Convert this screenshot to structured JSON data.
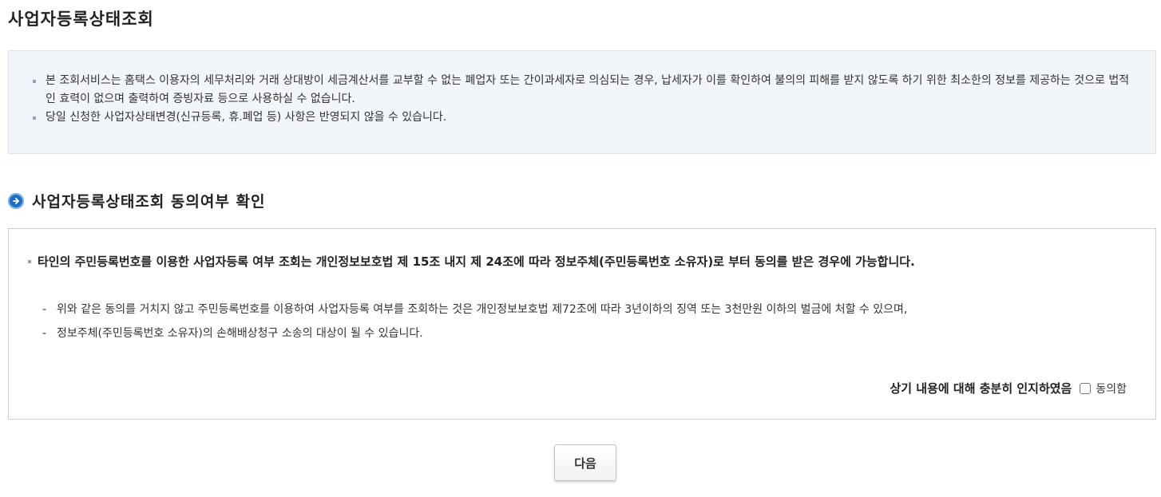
{
  "page": {
    "title": "사업자등록상태조회"
  },
  "notice": {
    "items": [
      "본 조회서비스는 홈택스 이용자의 세무처리와 거래 상대방이 세금계산서를 교부할 수 없는 폐업자 또는 간이과세자로 의심되는 경우, 납세자가 이를 확인하여 불의의 피해를 받지 않도록 하기 위한 최소한의 정보를 제공하는 것으로 법적인 효력이 없으며 출력하여 증빙자료 등으로 사용하실 수 없습니다.",
      "당일 신청한 사업자상태변경(신규등록, 휴.폐업 등) 사항은 반영되지 않을 수 있습니다."
    ]
  },
  "consent_section": {
    "title": "사업자등록상태조회 동의여부 확인",
    "main_text": "타인의 주민등록번호를 이용한 사업자등록 여부 조회는 개인정보보호법 제 15조 내지 제 24조에 따라 정보주체(주민등록번호 소유자)로 부터 동의를 받은 경우에 가능합니다.",
    "warnings": [
      "위와 같은 동의를 거치지 않고 주민등록번호를 이용하여 사업자등록 여부를 조회하는 것은 개인정보보호법 제72조에 따라 3년이하의 징역 또는 3천만원 이하의 벌금에 처할 수 있으며,",
      "정보주체(주민등록번호 소유자)의 손해배상청구 소송의 대상이 될 수 있습니다."
    ],
    "acknowledge_text": "상기 내용에 대해 충분히 인지하였음",
    "checkbox_label": "동의함",
    "checkbox_checked": false
  },
  "actions": {
    "next_label": "다음"
  },
  "colors": {
    "notice_bg": "#f2f5fa",
    "section_icon": "#1e6fc0"
  }
}
